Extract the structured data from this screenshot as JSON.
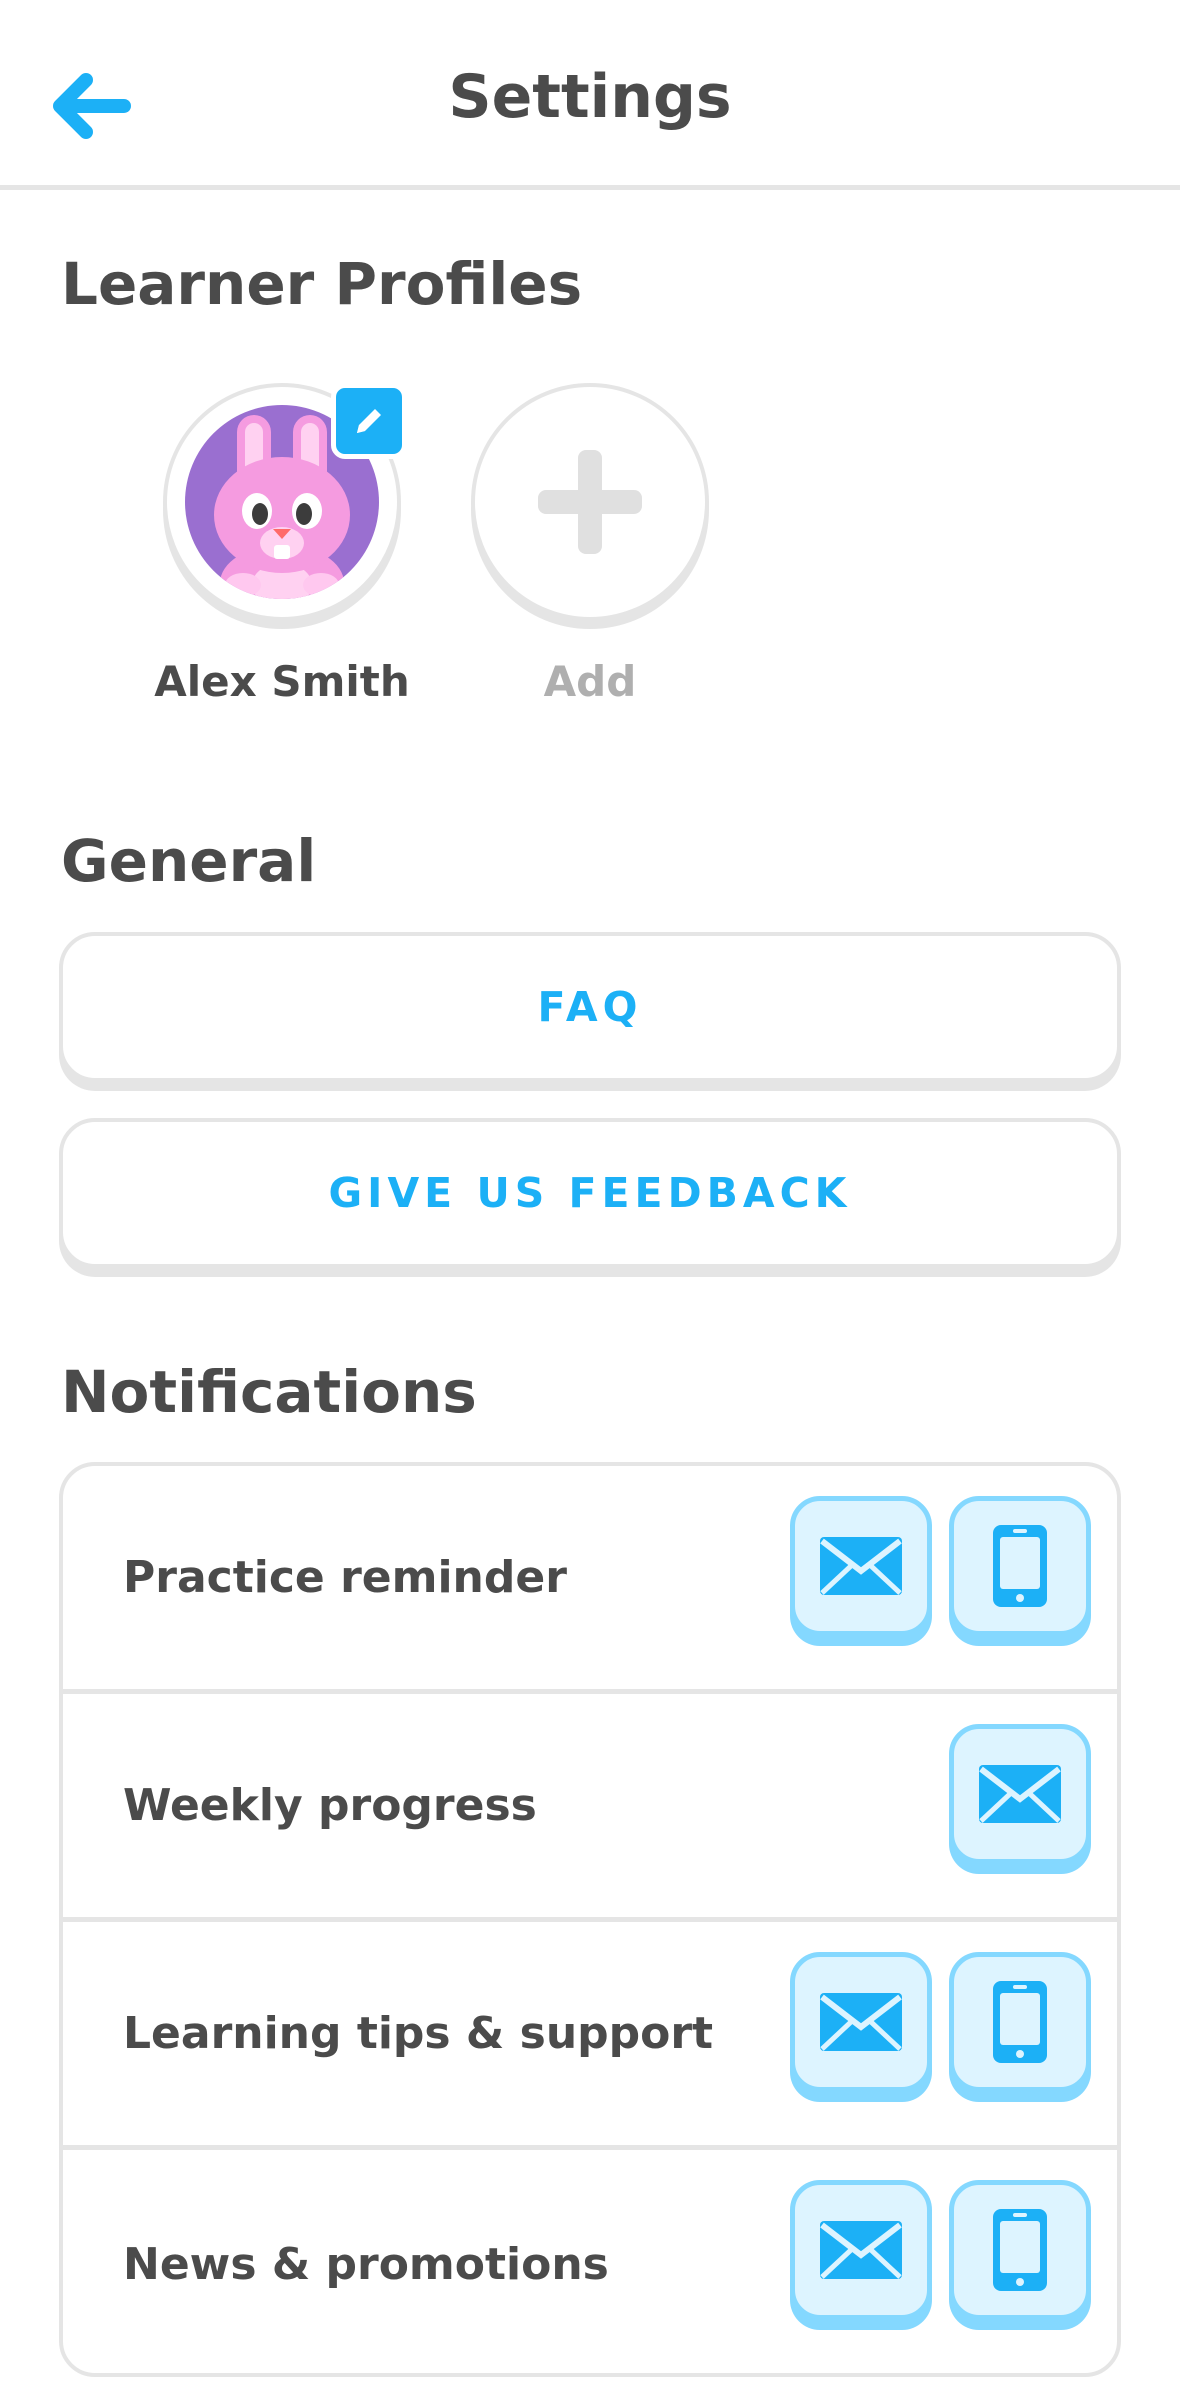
{
  "header": {
    "title": "Settings",
    "back_icon": "arrow-left-icon"
  },
  "learner_profiles": {
    "heading": "Learner Profiles",
    "profiles": [
      {
        "name": "Alex Smith",
        "avatar": "pink-bunny-avatar",
        "badge_icon": "pencil-icon"
      }
    ],
    "add_label": "Add",
    "add_icon": "plus-icon"
  },
  "general": {
    "heading": "General",
    "buttons": [
      "FAQ",
      "GIVE US FEEDBACK"
    ]
  },
  "notifications": {
    "heading": "Notifications",
    "rows": [
      {
        "label": "Practice reminder",
        "email": true,
        "push": true
      },
      {
        "label": "Weekly progress",
        "email": true,
        "push": null
      },
      {
        "label": "Learning tips & support",
        "email": true,
        "push": true
      },
      {
        "label": "News & promotions",
        "email": true,
        "push": true
      }
    ]
  },
  "colors": {
    "accent": "#1cb0f6",
    "toggle_fill": "#ddf4ff",
    "toggle_border": "#84d8ff",
    "text": "#4b4b4b",
    "muted": "#afafaf",
    "divider": "#e5e5e5",
    "avatar_bg": "#9a6fd0"
  }
}
